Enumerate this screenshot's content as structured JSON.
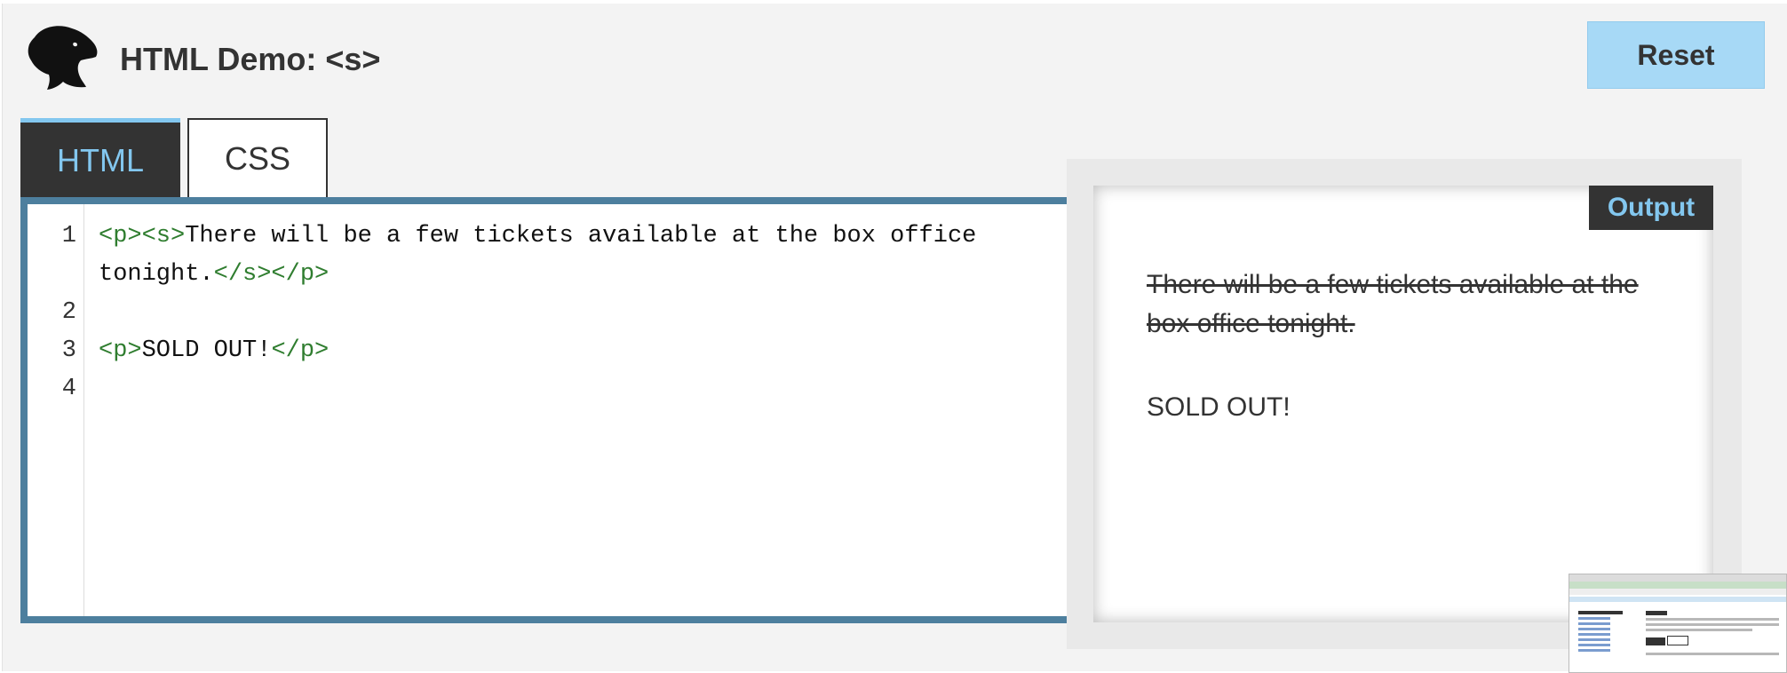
{
  "header": {
    "title": "HTML Demo: <s>",
    "reset_label": "Reset"
  },
  "tabs": [
    {
      "label": "HTML",
      "active": true
    },
    {
      "label": "CSS",
      "active": false
    }
  ],
  "editor": {
    "line_numbers": [
      "1",
      "2",
      "3",
      "4"
    ],
    "lines": [
      {
        "tag_open": "<p><s>",
        "text": "There will be a few tickets available at the box office"
      },
      {
        "text": "tonight.",
        "tag_close": "</s></p>"
      },
      {
        "tag_open": "<p>",
        "text": "SOLD OUT!",
        "tag_close": "</p>"
      }
    ]
  },
  "output": {
    "label": "Output",
    "strike_text": "There will be a few tickets available at the box office tonight.",
    "sold_text": "SOLD OUT!"
  },
  "colors": {
    "accent_blue": "#83c7ef",
    "reset_bg": "#a7d9f6",
    "editor_border": "#4d7f9e",
    "tag_green": "#2f7d2f",
    "dark": "#333333"
  },
  "icons": {
    "logo": "dinosaur-logo-icon"
  }
}
